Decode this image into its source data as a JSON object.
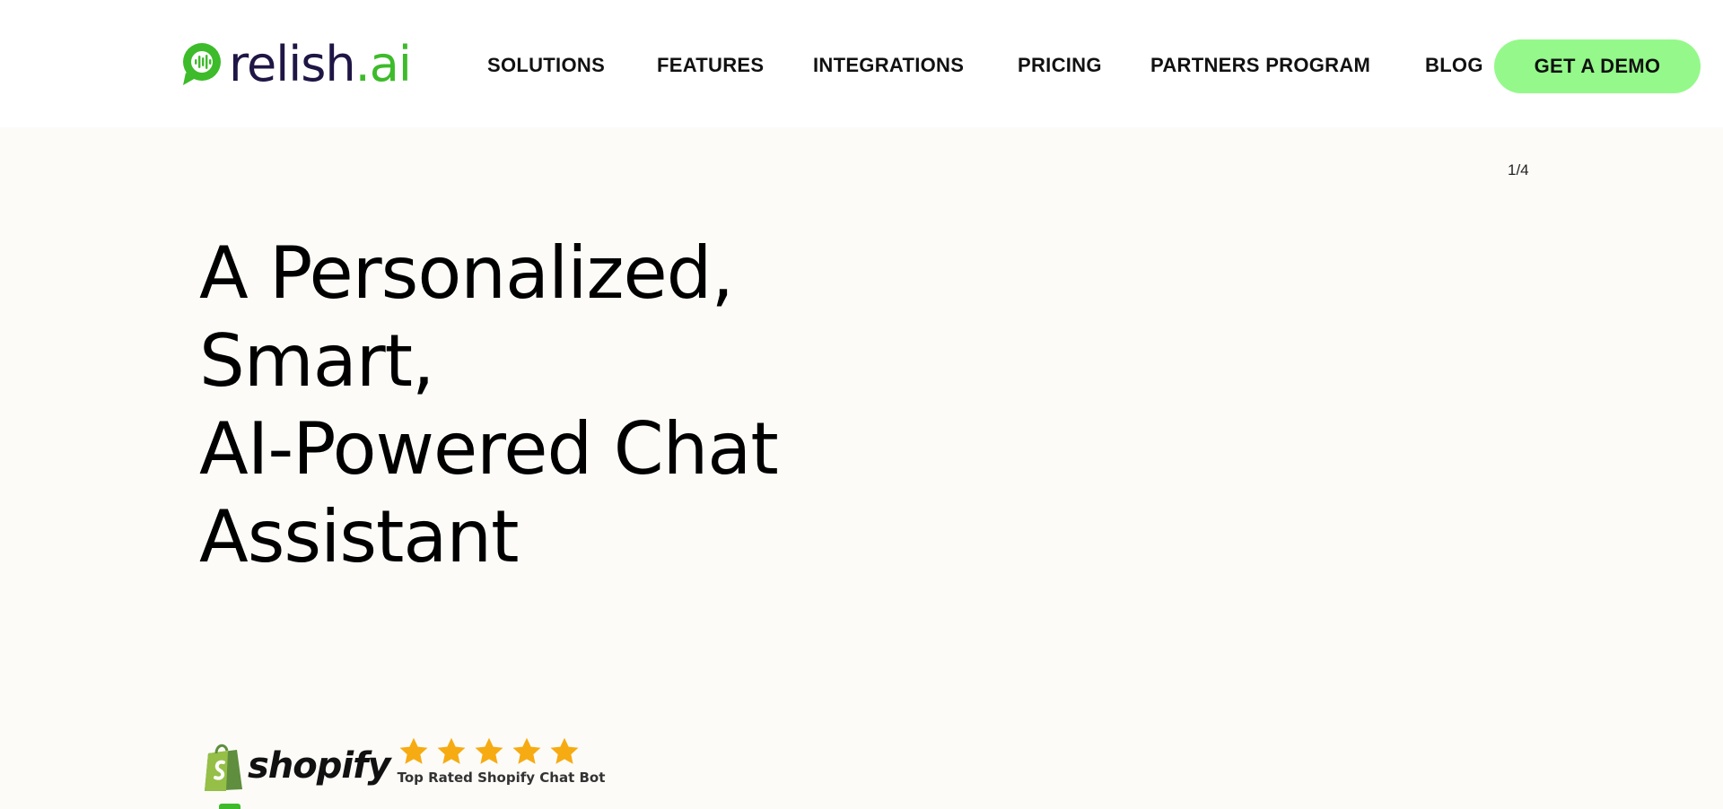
{
  "header": {
    "logo": {
      "name": "relish",
      "dot": ".",
      "suffix": "ai",
      "brand_dark": "#1f1646",
      "brand_green": "#3dbb2a"
    },
    "nav": [
      {
        "label": "SOLUTIONS"
      },
      {
        "label": "FEATURES"
      },
      {
        "label": "INTEGRATIONS"
      },
      {
        "label": "PRICING"
      },
      {
        "label": "PARTNERS PROGRAM"
      },
      {
        "label": "BLOG"
      }
    ],
    "cta_label": "GET A DEMO",
    "cta_color": "#94f98a"
  },
  "hero": {
    "slide_counter": "1/4",
    "title_lines": [
      "A Personalized,",
      "Smart,",
      "AI-Powered Chat",
      "Assistant"
    ]
  },
  "badge": {
    "platform": "shopify",
    "stars": 5,
    "star_color": "#f7ab12",
    "label": "Top Rated Shopify Chat Bot"
  },
  "icons": {
    "logo_icon": "chat-bubble-soundwave-icon",
    "shopify_icon": "shopping-bag-icon",
    "star_icon": "star-icon"
  },
  "colors": {
    "page_background": "#fcfbf8",
    "header_background": "#ffffff"
  }
}
